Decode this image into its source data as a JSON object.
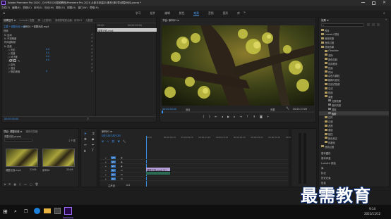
{
  "titlebar": {
    "title": "Adobe Premiere Pro 2020 - D:\\PR2020视频教程\\Premiere Pro 2020 从新手到高手\\素材\\第3章\\调整光线.prproj *"
  },
  "menubar": {
    "items": [
      "文件(F)",
      "编辑(E)",
      "剪辑(C)",
      "序列(S)",
      "标记(M)",
      "图形(G)",
      "视图(V)",
      "窗口(W)",
      "帮助(H)"
    ]
  },
  "workspaces": {
    "items": [
      "学习",
      "组件",
      "编辑",
      "颜色",
      "效果",
      "音频",
      "图形",
      "库"
    ],
    "active_index": 4
  },
  "effect_controls": {
    "tabs": [
      "效果控件 ≡",
      "Lumetri 范围",
      "源：(无剪辑)",
      "音频剪辑混合器：序列01",
      "元数据"
    ],
    "source_label": "主要 * 调整光线.mp4",
    "sequence_label": "序列01 * 调整光线.mp4",
    "timecode_start": "00:00",
    "timecode_end": "00:00:05:00",
    "clip_label": "调整光线.mp4",
    "video_label": "视频",
    "rows": [
      {
        "label": "fx 运动",
        "value": ""
      },
      {
        "label": "fx 不透明度",
        "value": ""
      },
      {
        "label": "时间重映射",
        "value": ""
      },
      {
        "label": "fx 亮度",
        "value": ""
      },
      {
        "label": "○ 光影",
        "value": "0.0"
      },
      {
        "label": "○ 亮度",
        "value": "0.0"
      },
      {
        "label": "○ 对比度",
        "value": "0.0"
      },
      {
        "label": "○ 阴影",
        "value": "0.0"
      },
      {
        "label": "○ 高光",
        "value": ""
      },
      {
        "label": "○ 混合",
        "value": ""
      },
      {
        "label": "○ 阴影阈值",
        "value": "0"
      }
    ],
    "footer_timecode": "00:00:00:00"
  },
  "program_monitor": {
    "title": "节目: 序列01 ≡",
    "timecode": "00:00:00:00",
    "fit_label": "适合",
    "quality_label": "完整",
    "duration": "00:00:23:09"
  },
  "effects_panel": {
    "title": "效果 ≡",
    "search_placeholder": "",
    "items": [
      {
        "label": "预设",
        "indent": 0,
        "selected": false
      },
      {
        "label": "Lumetri 预设",
        "indent": 0,
        "selected": false
      },
      {
        "label": "音频效果",
        "indent": 0,
        "selected": false
      },
      {
        "label": "音频过渡",
        "indent": 0,
        "selected": false
      },
      {
        "label": "视频效果",
        "indent": 0,
        "selected": false
      },
      {
        "label": "Obsolete",
        "indent": 1,
        "selected": false
      },
      {
        "label": "变换",
        "indent": 1,
        "selected": false
      },
      {
        "label": "图像控制",
        "indent": 1,
        "selected": false
      },
      {
        "label": "实用程序",
        "indent": 1,
        "selected": false
      },
      {
        "label": "扭曲",
        "indent": 1,
        "selected": false
      },
      {
        "label": "时间",
        "indent": 1,
        "selected": false
      },
      {
        "label": "杂色与颗粒",
        "indent": 1,
        "selected": false
      },
      {
        "label": "模糊与锐化",
        "indent": 1,
        "selected": false
      },
      {
        "label": "沉浸式视频",
        "indent": 1,
        "selected": false
      },
      {
        "label": "生成",
        "indent": 1,
        "selected": false
      },
      {
        "label": "视频",
        "indent": 1,
        "selected": false
      },
      {
        "label": "调整",
        "indent": 1,
        "selected": false
      },
      {
        "label": "光照效果",
        "indent": 2,
        "selected": false
      },
      {
        "label": "卷积内核",
        "indent": 2,
        "selected": false
      },
      {
        "label": "提取",
        "indent": 2,
        "selected": false
      },
      {
        "label": "色阶",
        "indent": 2,
        "selected": true
      },
      {
        "label": "过时",
        "indent": 1,
        "selected": false
      },
      {
        "label": "过渡",
        "indent": 1,
        "selected": false
      },
      {
        "label": "透视",
        "indent": 1,
        "selected": false
      },
      {
        "label": "通道",
        "indent": 1,
        "selected": false
      },
      {
        "label": "键控",
        "indent": 1,
        "selected": false
      },
      {
        "label": "颜色校正",
        "indent": 1,
        "selected": false
      },
      {
        "label": "风格化",
        "indent": 1,
        "selected": false
      },
      {
        "label": "视频过渡",
        "indent": 0,
        "selected": false
      }
    ],
    "sections": [
      "基本图形",
      "基本声音",
      "Lumetri 颜色",
      "库",
      "标记",
      "历史记录",
      "信息"
    ]
  },
  "project_panel": {
    "tabs": [
      "项目: 调整光线 ≡",
      "媒体浏览器"
    ],
    "file_label": "调整光线.prproj",
    "count_label": "1 个项",
    "clips": [
      {
        "name": "调整光线.mp4",
        "duration": "23:09"
      },
      {
        "name": "序列01",
        "duration": "23:09"
      }
    ]
  },
  "timeline": {
    "title": "序列01 ≡",
    "timecode": "00:00:00:00",
    "ruler": [
      "00:00",
      "00:00:04:23",
      "00:00:09:23",
      "00:00:14:23",
      "00:00:19:23",
      "00:00:24:23",
      "00:00:29:23",
      "00:00:34:23",
      "00:00:39:23"
    ],
    "tracks": [
      "V3",
      "V2",
      "V1",
      "A1",
      "A2",
      "A3"
    ],
    "master_label": "主声道",
    "master_value": "0.0",
    "clip_label": "调整光线.mp4 [V]"
  },
  "watermark": {
    "text": "最需教育"
  },
  "taskbar": {
    "time": "9:14",
    "date": "2021/11/12"
  }
}
